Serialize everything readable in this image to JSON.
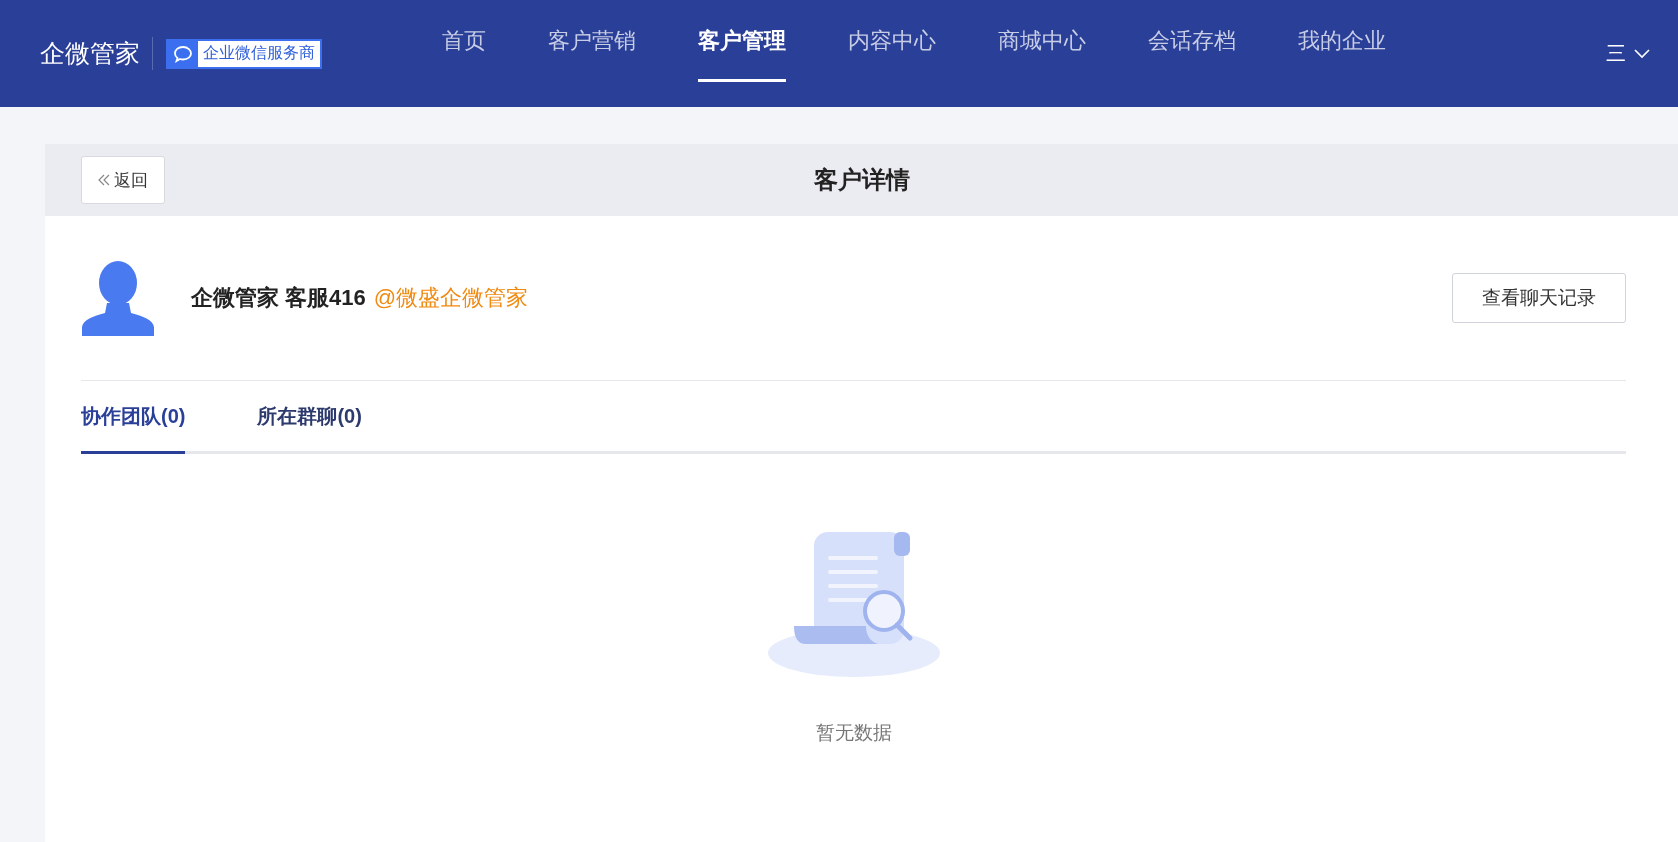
{
  "header": {
    "logo": "企微管家",
    "badge": "企业微信服务商",
    "nav": [
      {
        "label": "首页",
        "selected": false
      },
      {
        "label": "客户营销",
        "selected": false
      },
      {
        "label": "客户管理",
        "selected": true
      },
      {
        "label": "内容中心",
        "selected": false
      },
      {
        "label": "商城中心",
        "selected": false
      },
      {
        "label": "会话存档",
        "selected": false
      },
      {
        "label": "我的企业",
        "selected": false
      }
    ],
    "menu": "三"
  },
  "page": {
    "back": "返回",
    "title": "客户详情"
  },
  "customer": {
    "name": "企微管家 客服416",
    "corp": "@微盛企微管家",
    "button": "查看聊天记录"
  },
  "tabs": [
    {
      "label": "协作团队(0)",
      "selected": true
    },
    {
      "label": "所在群聊(0)",
      "selected": false
    }
  ],
  "empty": {
    "text": "暂无数据"
  }
}
